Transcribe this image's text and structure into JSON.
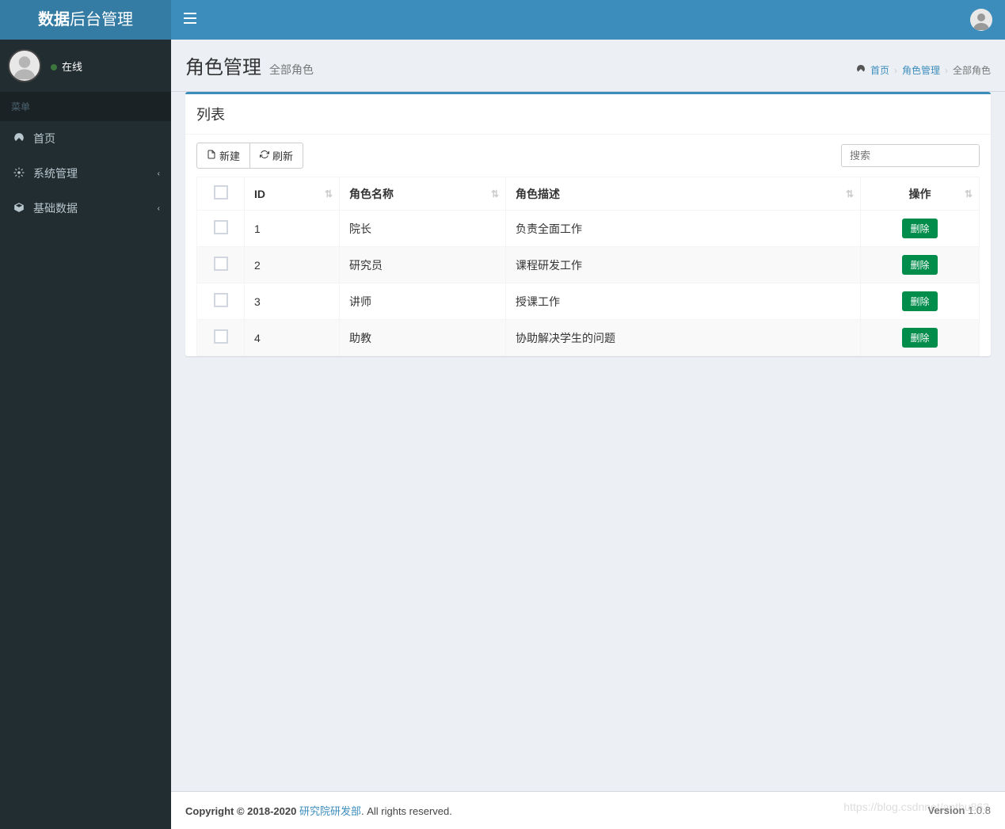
{
  "brand": {
    "bold": "数据",
    "rest": "后台管理"
  },
  "user": {
    "status": "在线"
  },
  "sidebar": {
    "menu_header": "菜单",
    "items": [
      {
        "icon": "dashboard",
        "label": "首页",
        "has_children": false
      },
      {
        "icon": "cogs",
        "label": "系统管理",
        "has_children": true
      },
      {
        "icon": "cube",
        "label": "基础数据",
        "has_children": true
      }
    ]
  },
  "page": {
    "title": "角色管理",
    "subtitle": "全部角色"
  },
  "breadcrumb": {
    "home_icon": "dashboard",
    "items": [
      "首页",
      "角色管理",
      "全部角色"
    ]
  },
  "box": {
    "title": "列表",
    "new_button": "新建",
    "refresh_button": "刷新",
    "search_placeholder": "搜索"
  },
  "table": {
    "headers": {
      "id": "ID",
      "name": "角色名称",
      "desc": "角色描述",
      "action": "操作"
    },
    "delete_label": "删除",
    "rows": [
      {
        "id": "1",
        "name": "院长",
        "desc": "负责全面工作"
      },
      {
        "id": "2",
        "name": "研究员",
        "desc": "课程研发工作"
      },
      {
        "id": "3",
        "name": "讲师",
        "desc": "授课工作"
      },
      {
        "id": "4",
        "name": "助教",
        "desc": "协助解决学生的问题"
      }
    ]
  },
  "footer": {
    "copyright_prefix": "Copyright © 2018-2020 ",
    "org": "研究院研发部",
    "rights": ". All rights reserved.",
    "version_label": "Version",
    "version": "1.0.8"
  },
  "watermark": "https://blog.csdnnet/anthu863"
}
